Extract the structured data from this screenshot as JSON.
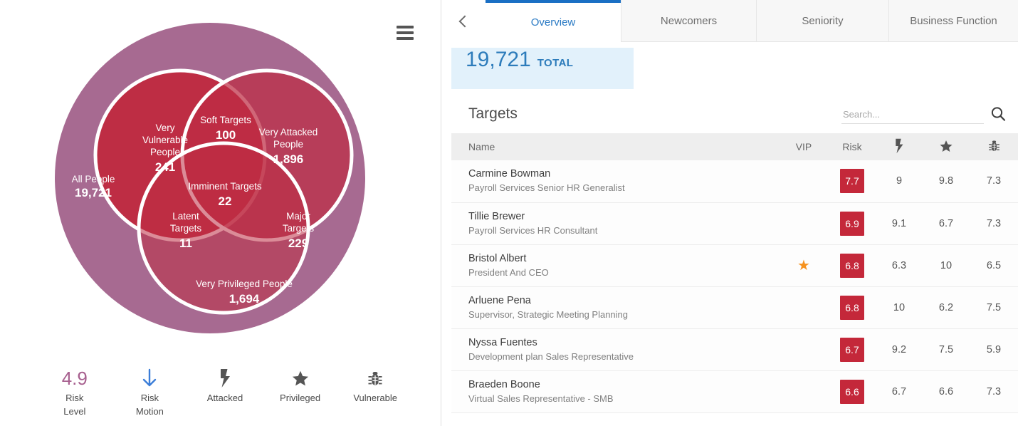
{
  "left_panel": {
    "menu_icon": "hamburger-icon",
    "venn": {
      "outer": {
        "label": "All People",
        "value": "19,721"
      },
      "vulnerable": {
        "label": "Very\nVulnerable\nPeople",
        "line1": "Very",
        "line2": "Vulnerable",
        "line3": "People",
        "value": "241"
      },
      "attacked": {
        "line1": "Very Attacked",
        "line2": "People",
        "value": "1,896"
      },
      "privileged": {
        "line1": "Very Privileged People",
        "value": "1,694"
      },
      "soft": {
        "line1": "Soft Targets",
        "value": "100"
      },
      "imminent": {
        "line1": "Imminent Targets",
        "value": "22"
      },
      "latent": {
        "line1": "Latent",
        "line2": "Targets",
        "value": "11"
      },
      "major": {
        "line1": "Major",
        "line2": "Targets",
        "value": "229"
      }
    },
    "metrics": [
      {
        "value": "4.9",
        "label_line1": "Risk",
        "label_line2": "Level",
        "icon": "risk-level-number"
      },
      {
        "value": "",
        "label_line1": "Risk",
        "label_line2": "Motion",
        "icon": "down-arrow-icon"
      },
      {
        "value": "",
        "label_line1": "Attacked",
        "label_line2": "",
        "icon": "lightning-bolt-icon"
      },
      {
        "value": "",
        "label_line1": "Privileged",
        "label_line2": "",
        "icon": "star-icon"
      },
      {
        "value": "",
        "label_line1": "Vulnerable",
        "label_line2": "",
        "icon": "bug-icon"
      }
    ]
  },
  "right_panel": {
    "back_icon": "chevron-left-icon",
    "tabs": [
      {
        "label": "Overview",
        "active": true
      },
      {
        "label": "Newcomers",
        "active": false
      },
      {
        "label": "Seniority",
        "active": false
      },
      {
        "label": "Business Function",
        "active": false
      }
    ],
    "total": {
      "number": "19,721",
      "word": "TOTAL"
    },
    "card": {
      "title": "Targets",
      "search_placeholder": "Search...",
      "search_value": "",
      "search_icon": "magnifier-icon"
    },
    "table": {
      "headers": {
        "name": "Name",
        "vip": "VIP",
        "risk": "Risk",
        "attacked": "lightning-bolt-icon",
        "privileged": "star-icon",
        "vulnerable": "bug-icon"
      },
      "rows": [
        {
          "name": "Carmine Bowman",
          "title": "Payroll Services Senior HR Generalist",
          "vip": "",
          "risk": "7.7",
          "attacked": "9",
          "privileged": "9.8",
          "vulnerable": "7.3"
        },
        {
          "name": "Tillie Brewer",
          "title": "Payroll Services HR Consultant",
          "vip": "",
          "risk": "6.9",
          "attacked": "9.1",
          "privileged": "6.7",
          "vulnerable": "7.3"
        },
        {
          "name": "Bristol Albert",
          "title": "President And CEO",
          "vip": "★",
          "risk": "6.8",
          "attacked": "6.3",
          "privileged": "10",
          "vulnerable": "6.5"
        },
        {
          "name": "Arluene Pena",
          "title": "Supervisor, Strategic Meeting Planning",
          "vip": "",
          "risk": "6.8",
          "attacked": "10",
          "privileged": "6.2",
          "vulnerable": "7.5"
        },
        {
          "name": "Nyssa Fuentes",
          "title": "Development plan Sales Representative",
          "vip": "",
          "risk": "6.7",
          "attacked": "9.2",
          "privileged": "7.5",
          "vulnerable": "5.9"
        },
        {
          "name": "Braeden Boone",
          "title": "Virtual Sales Representative - SMB",
          "vip": "",
          "risk": "6.6",
          "attacked": "6.7",
          "privileged": "6.6",
          "vulnerable": "7.3"
        }
      ]
    }
  },
  "colors": {
    "outer_circle": "#a76a91",
    "inner_circle": "#be2d44",
    "risk_badge": "#c4283a",
    "accent_blue": "#2a7ac4",
    "total_bg": "#e2f1fb",
    "vip_star": "#f6921e",
    "risk_level_text": "#a7608f",
    "arrow_blue": "#3b7dd8"
  },
  "chart_data": {
    "type": "venn",
    "title": "People risk Venn diagram",
    "sets": [
      {
        "name": "All People",
        "value": 19721
      },
      {
        "name": "Very Vulnerable People",
        "value": 241
      },
      {
        "name": "Very Attacked People",
        "value": 1896
      },
      {
        "name": "Very Privileged People",
        "value": 1694
      }
    ],
    "intersections": [
      {
        "name": "Soft Targets",
        "sets": [
          "Very Vulnerable People",
          "Very Attacked People"
        ],
        "value": 100
      },
      {
        "name": "Imminent Targets",
        "sets": [
          "Very Vulnerable People",
          "Very Attacked People",
          "Very Privileged People"
        ],
        "value": 22
      },
      {
        "name": "Latent Targets",
        "sets": [
          "Very Vulnerable People",
          "Very Privileged People"
        ],
        "value": 11
      },
      {
        "name": "Major Targets",
        "sets": [
          "Very Attacked People",
          "Very Privileged People"
        ],
        "value": 229
      }
    ],
    "legend_position": "bottom",
    "annotations": [
      "Risk Level 4.9",
      "Risk Motion down"
    ]
  }
}
